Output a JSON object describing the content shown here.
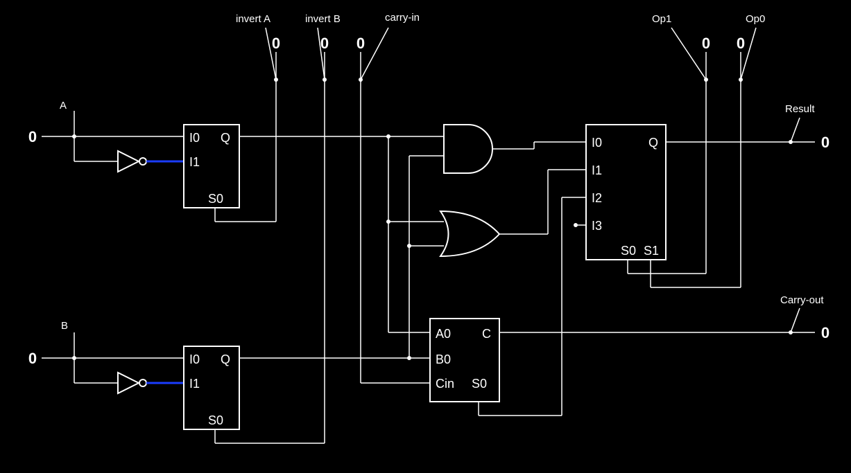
{
  "labels": {
    "invertA": "invert A",
    "invertB": "invert B",
    "carryIn": "carry-in",
    "op1": "Op1",
    "op0": "Op0",
    "A": "A",
    "B": "B",
    "Result": "Result",
    "CarryOut": "Carry-out"
  },
  "io": {
    "A": "0",
    "B": "0",
    "invertA": "0",
    "invertB": "0",
    "carryIn": "0",
    "op1": "0",
    "op0": "0",
    "Result": "0",
    "CarryOut": "0"
  },
  "mux2": {
    "i0": "I0",
    "i1": "I1",
    "q": "Q",
    "s0": "S0"
  },
  "mux4": {
    "i0": "I0",
    "i1": "I1",
    "i2": "I2",
    "i3": "I3",
    "q": "Q",
    "s0": "S0",
    "s1": "S1"
  },
  "adder": {
    "a0": "A0",
    "b0": "B0",
    "cin": "Cin",
    "c": "C",
    "s0": "S0"
  }
}
